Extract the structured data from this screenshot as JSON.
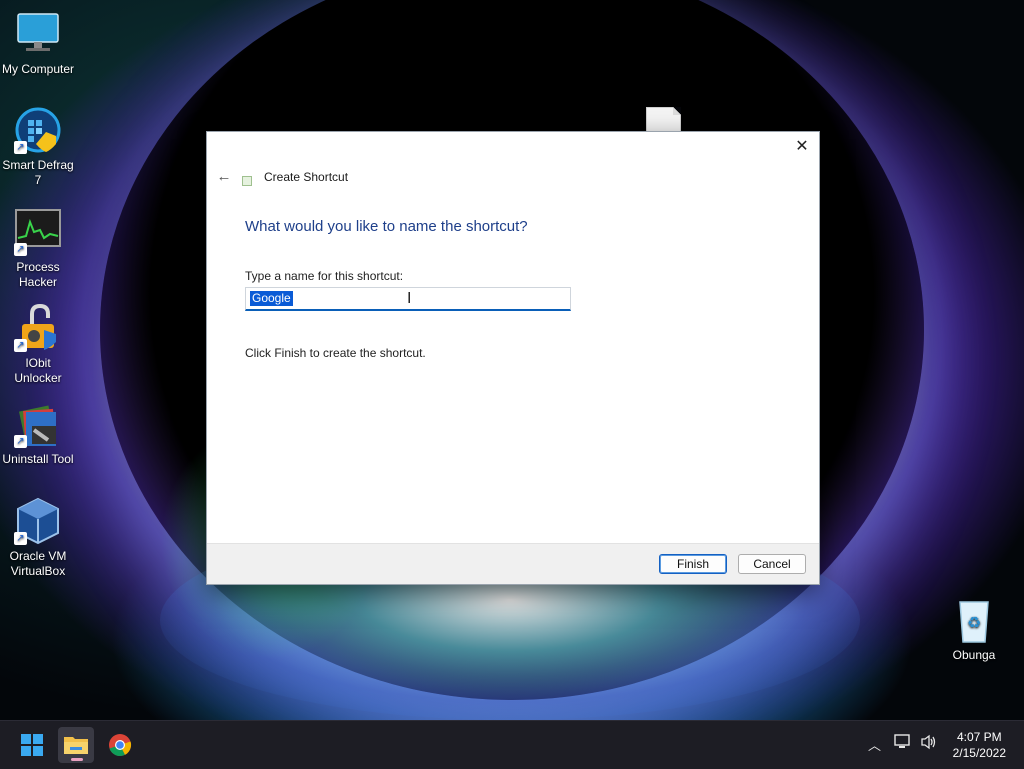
{
  "desktop": {
    "icons": [
      {
        "label": "My Computer"
      },
      {
        "label": "Smart Defrag 7"
      },
      {
        "label": "Process Hacker"
      },
      {
        "label": "IObit Unlocker"
      },
      {
        "label": "Uninstall Tool"
      },
      {
        "label": "Oracle VM VirtualBox"
      },
      {
        "label": "Obunga"
      }
    ]
  },
  "dialog": {
    "title": "Create Shortcut",
    "heading": "What would you like to name the shortcut?",
    "field_label": "Type a name for this shortcut:",
    "name_value": "Google",
    "info": "Click Finish to create the shortcut.",
    "finish_label": "Finish",
    "cancel_label": "Cancel",
    "close_glyph": "✕",
    "back_glyph": "←"
  },
  "taskbar": {
    "time": "4:07 PM",
    "date": "2/15/2022"
  },
  "colors": {
    "accent": "#0a5fb8",
    "heading": "#1e3f8a"
  }
}
